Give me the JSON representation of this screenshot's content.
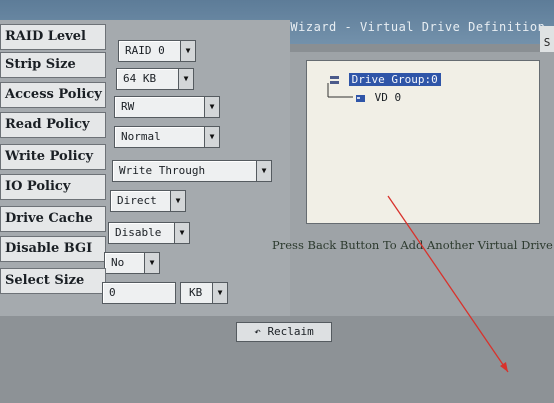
{
  "window": {
    "title": "Virtual Drive Definition",
    "title_prefix_partial": "...iguration Wizard -",
    "side_tab": "S"
  },
  "form": {
    "raid_level": {
      "label": "RAID Level",
      "value": "RAID 0"
    },
    "strip_size": {
      "label": "Strip Size",
      "value": "64 KB"
    },
    "access_policy": {
      "label": "Access Policy",
      "value": "RW"
    },
    "read_policy": {
      "label": "Read Policy",
      "value": "Normal"
    },
    "write_policy": {
      "label": "Write Policy",
      "value": "Write Through"
    },
    "io_policy": {
      "label": "IO Policy",
      "value": "Direct"
    },
    "drive_cache": {
      "label": "Drive Cache",
      "value": "Disable"
    },
    "disable_bgi": {
      "label": "Disable BGI",
      "value": "No"
    },
    "select_size": {
      "label": "Select Size",
      "value": "0",
      "unit": "KB"
    }
  },
  "tree": {
    "drive_group": "Drive Group:0",
    "virtual_drive": "VD 0"
  },
  "hint": "Press Back Button To Add Another Virtual Drive",
  "buttons": {
    "reclaim": "Reclaim"
  },
  "icons": {
    "dropdown": "triangle-down",
    "reclaim": "undo-arrow",
    "drive_group": "drive-stack",
    "virtual_drive": "drive"
  },
  "colors": {
    "selection": "#2f55a8",
    "pointer_arrow": "#d8322c"
  }
}
